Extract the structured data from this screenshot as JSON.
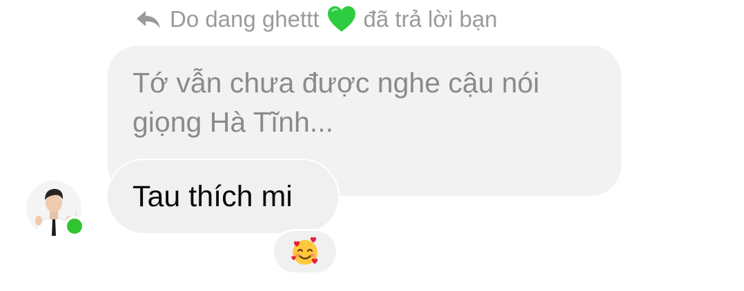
{
  "reply_header": {
    "sender": "Do dang ghettt",
    "heart_icon": "green-heart-icon",
    "suffix": "đã trả lời bạn",
    "reply_icon": "reply-arrow-icon"
  },
  "quoted_message": {
    "text": "Tớ vẫn chưa được nghe cậu nói giọng Hà Tĩnh..."
  },
  "message": {
    "text": "Tau thích mi"
  },
  "reaction": {
    "emoji": "🥰",
    "icon": "smiling-face-with-hearts-icon"
  },
  "sender_status": {
    "online": true,
    "online_color": "#31c431"
  },
  "colors": {
    "bubble": "#f0f0f0",
    "muted_text": "#8a8a8a",
    "heart": "#2ecc40"
  }
}
